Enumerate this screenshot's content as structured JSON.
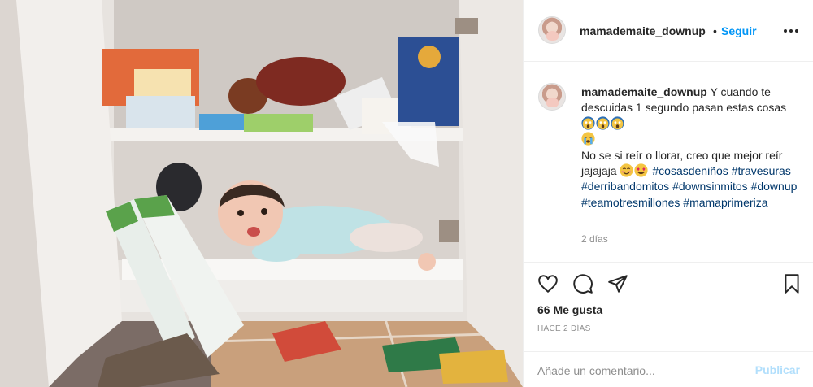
{
  "post": {
    "image_alt": "Bebé acostada dentro de un mueble de cocina"
  },
  "header": {
    "username": "mamademaite_downup",
    "separator": "•",
    "follow_label": "Seguir",
    "more_icon": "more-horizontal-icon"
  },
  "caption": {
    "username": "mamademaite_downup",
    "text_1": " Y cuando te descuidas 1 segundo pasan estas cosas ",
    "text_2": "No se si reír o llorar, creo que mejor reír jajajaja ",
    "hashtags": [
      "#cosasdeniños",
      "#travesuras",
      "#derribandomitos",
      "#downsinmitos",
      "#downup",
      "#teamotresmillones",
      "#mamaprimeriza"
    ],
    "time_ago": "2 días",
    "emojis": [
      "screaming-face-icon",
      "screaming-face-icon",
      "screaming-face-icon",
      "crying-face-icon",
      "smiling-face-icon",
      "heart-eyes-icon"
    ]
  },
  "actions": {
    "like_icon": "heart-icon",
    "comment_icon": "comment-icon",
    "share_icon": "paper-plane-icon",
    "save_icon": "bookmark-icon",
    "likes": "66 Me gusta",
    "date": "HACE 2 DÍAS"
  },
  "comment_box": {
    "placeholder": "Añade un comentario...",
    "publish_label": "Publicar"
  },
  "colors": {
    "link": "#0095f6",
    "hashtag": "#00376b",
    "muted": "#8e8e8e",
    "publish_disabled": "#b2dffc"
  }
}
